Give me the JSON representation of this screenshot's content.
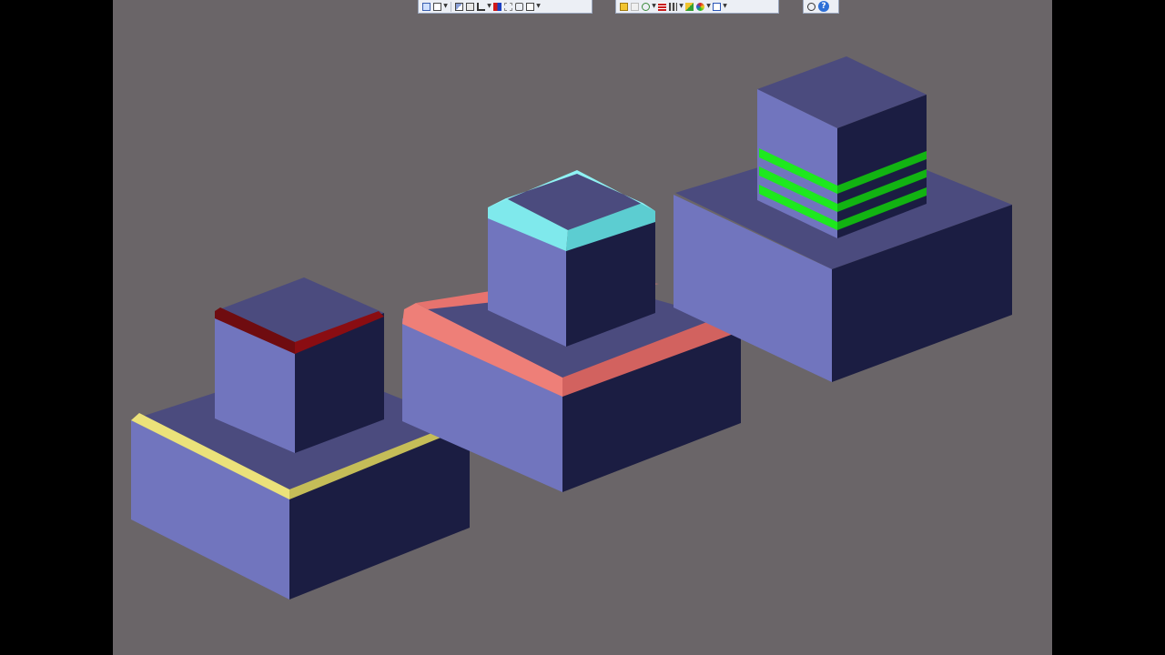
{
  "app": {
    "background_color": "#6a6568",
    "frame_color": "#000000"
  },
  "toolbars": [
    {
      "name": "view-toolbar",
      "buttons": [
        "view-orient-icon",
        "zoom-box-icon",
        "display-style-icon",
        "section-view-icon",
        "view-settings-icon",
        "hide-show-icon",
        "edit-appearance-icon",
        "apply-scene-icon",
        "view-setting-icon"
      ]
    },
    {
      "name": "feature-toolbar",
      "buttons": [
        "extrude-boss-icon",
        "cut-icon",
        "fillet-icon",
        "chamfer-icon",
        "pattern-icon",
        "appearance-icon",
        "color-wheel-icon",
        "reference-geometry-icon"
      ]
    },
    {
      "name": "help-toolbar",
      "buttons": [
        "search-zoom-icon",
        "help-icon"
      ]
    }
  ],
  "help_label": "?",
  "colors": {
    "face_top": "#4b4b7e",
    "face_left": "#7175be",
    "face_right": "#1b1d42",
    "edge_yellow": "#ebe27a",
    "edge_yellow_dark": "#c5bd58",
    "edge_darkred": "#6f0c10",
    "edge_red": "#8a0d12",
    "fillet_salmon": "#ee7f78",
    "fillet_salmon_dark": "#d2625f",
    "chamfer_cyan": "#7fe9ec",
    "chamfer_cyan_dark": "#5ccdd1",
    "groove_green": "#1ee81e",
    "groove_green_dark": "#12b312"
  }
}
